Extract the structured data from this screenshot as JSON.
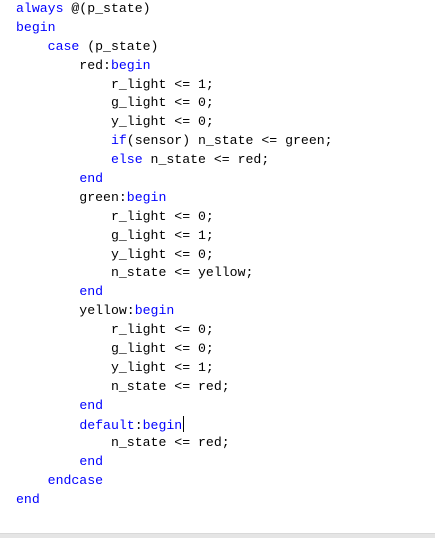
{
  "editor": {
    "lines": [
      [
        {
          "t": "always",
          "k": "kw"
        },
        {
          "t": " @(p_state)",
          "k": "tx"
        }
      ],
      [
        {
          "t": "begin",
          "k": "kw"
        }
      ],
      [
        {
          "t": "    ",
          "k": "tx"
        },
        {
          "t": "case",
          "k": "kw"
        },
        {
          "t": " (p_state)",
          "k": "tx"
        }
      ],
      [
        {
          "t": "        red:",
          "k": "tx"
        },
        {
          "t": "begin",
          "k": "kw"
        }
      ],
      [
        {
          "t": "            r_light <= 1;",
          "k": "tx"
        }
      ],
      [
        {
          "t": "            g_light <= 0;",
          "k": "tx"
        }
      ],
      [
        {
          "t": "            y_light <= 0;",
          "k": "tx"
        }
      ],
      [
        {
          "t": "            ",
          "k": "tx"
        },
        {
          "t": "if",
          "k": "kw"
        },
        {
          "t": "(sensor) n_state <= green;",
          "k": "tx"
        }
      ],
      [
        {
          "t": "            ",
          "k": "tx"
        },
        {
          "t": "else",
          "k": "kw"
        },
        {
          "t": " n_state <= red;",
          "k": "tx"
        }
      ],
      [
        {
          "t": "        ",
          "k": "tx"
        },
        {
          "t": "end",
          "k": "kw"
        }
      ],
      [
        {
          "t": "        green:",
          "k": "tx"
        },
        {
          "t": "begin",
          "k": "kw"
        }
      ],
      [
        {
          "t": "            r_light <= 0;",
          "k": "tx"
        }
      ],
      [
        {
          "t": "            g_light <= 1;",
          "k": "tx"
        }
      ],
      [
        {
          "t": "            y_light <= 0;",
          "k": "tx"
        }
      ],
      [
        {
          "t": "            n_state <= yellow;",
          "k": "tx"
        }
      ],
      [
        {
          "t": "        ",
          "k": "tx"
        },
        {
          "t": "end",
          "k": "kw"
        }
      ],
      [
        {
          "t": "        yellow:",
          "k": "tx"
        },
        {
          "t": "begin",
          "k": "kw"
        }
      ],
      [
        {
          "t": "            r_light <= 0;",
          "k": "tx"
        }
      ],
      [
        {
          "t": "            g_light <= 0;",
          "k": "tx"
        }
      ],
      [
        {
          "t": "            y_light <= 1;",
          "k": "tx"
        }
      ],
      [
        {
          "t": "            n_state <= red;",
          "k": "tx"
        }
      ],
      [
        {
          "t": "        ",
          "k": "tx"
        },
        {
          "t": "end",
          "k": "kw"
        }
      ],
      [
        {
          "t": "        ",
          "k": "tx"
        },
        {
          "t": "default",
          "k": "kw"
        },
        {
          "t": ":",
          "k": "tx"
        },
        {
          "t": "begin",
          "k": "kw"
        }
      ],
      [
        {
          "t": "            n_state <= red;",
          "k": "tx"
        }
      ],
      [
        {
          "t": "        ",
          "k": "tx"
        },
        {
          "t": "end",
          "k": "kw"
        }
      ],
      [
        {
          "t": "    ",
          "k": "tx"
        },
        {
          "t": "endcase",
          "k": "kw"
        }
      ],
      [
        {
          "t": "end",
          "k": "kw"
        }
      ]
    ],
    "caret_line": 22
  },
  "colors": {
    "keyword": "#0000ff",
    "text": "#000000",
    "background": "#ffffff"
  }
}
